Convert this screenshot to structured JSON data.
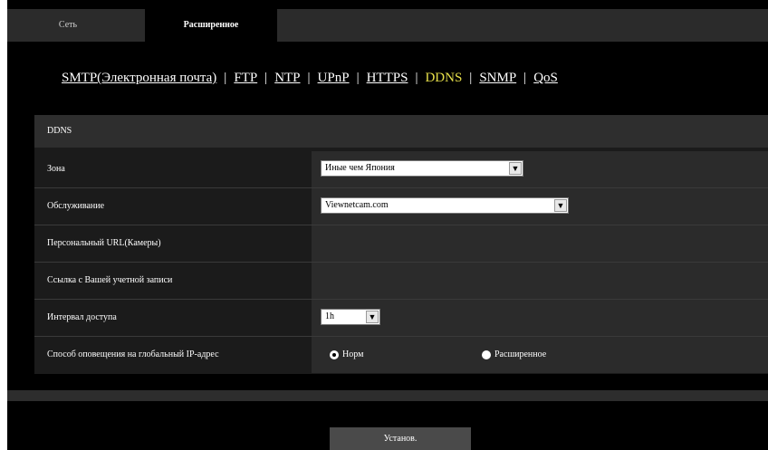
{
  "tabs": [
    {
      "label": "Сеть"
    },
    {
      "label": "Расширенное"
    }
  ],
  "subnav": {
    "items": [
      {
        "label": "SMTP(Электронная почта)"
      },
      {
        "label": "FTP"
      },
      {
        "label": "NTP"
      },
      {
        "label": "UPnP"
      },
      {
        "label": "HTTPS"
      },
      {
        "label": "DDNS"
      },
      {
        "label": "SNMP"
      },
      {
        "label": "QoS"
      }
    ],
    "separator": "|",
    "active": "DDNS"
  },
  "panel": {
    "title": "DDNS",
    "rows": [
      {
        "label": "Зона",
        "value": "Иные чем Япония"
      },
      {
        "label": "Обслуживание",
        "value": "Viewnetcam.com"
      },
      {
        "label": "Персональный URL(Камеры)"
      },
      {
        "label": "Ссылка с Вашей учетной записи"
      },
      {
        "label": "Интервал доступа",
        "value": "1h"
      },
      {
        "label": "Способ оповещения на глобальный IP-адрес",
        "options": [
          "Норм",
          "Расширенное"
        ],
        "selected": "Норм"
      }
    ]
  },
  "set_button": {
    "label": "Установ."
  },
  "icons": {
    "dropdown": "chevron-down-icon",
    "radio": "radio-icon"
  }
}
